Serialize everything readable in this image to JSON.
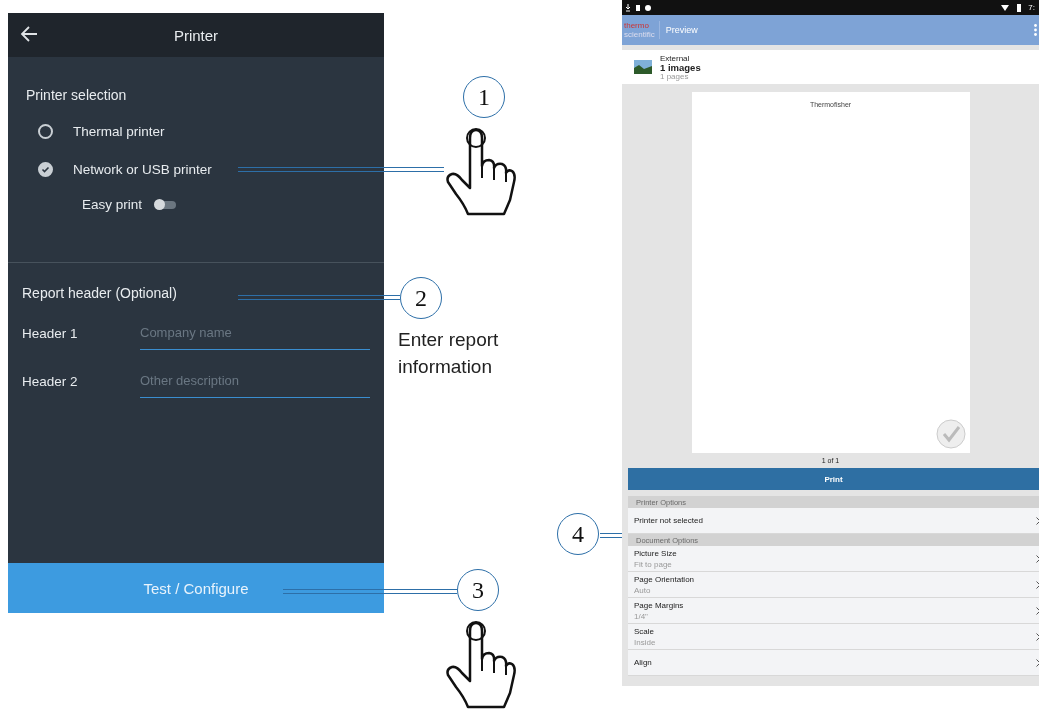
{
  "printer_screen": {
    "title": "Printer",
    "section_title": "Printer selection",
    "options": [
      {
        "label": "Thermal printer",
        "selected": false
      },
      {
        "label": "Network or USB printer",
        "selected": true
      }
    ],
    "easy_print": {
      "label": "Easy print",
      "on": false
    },
    "report_header": {
      "title": "Report header (Optional)",
      "fields": [
        {
          "label": "Header 1",
          "placeholder": "Company name"
        },
        {
          "label": "Header 2",
          "placeholder": "Other description"
        }
      ]
    },
    "button": "Test / Configure"
  },
  "callouts": [
    {
      "number": "1"
    },
    {
      "number": "2",
      "caption": "Enter report information"
    },
    {
      "number": "3"
    },
    {
      "number": "4"
    }
  ],
  "preview_screen": {
    "status_time": "7:",
    "app_title": "Preview",
    "logo_line_1": "thermo",
    "logo_line_2": "scientific",
    "document": {
      "source": "External",
      "title": "1 images",
      "pages": "1 pages"
    },
    "page_text": "Thermofisher",
    "page_counter": "1 of 1",
    "print_button": "Print",
    "sections": [
      {
        "title": "Printer Options",
        "rows": [
          {
            "label": "Printer not selected"
          }
        ]
      },
      {
        "title": "Document Options",
        "rows": [
          {
            "label": "Picture Size",
            "value": "Fit to page"
          },
          {
            "label": "Page Orientation",
            "value": "Auto"
          },
          {
            "label": "Page Margins",
            "value": "1/4\""
          },
          {
            "label": "Scale",
            "value": "Inside"
          },
          {
            "label": "Align"
          }
        ]
      }
    ]
  }
}
